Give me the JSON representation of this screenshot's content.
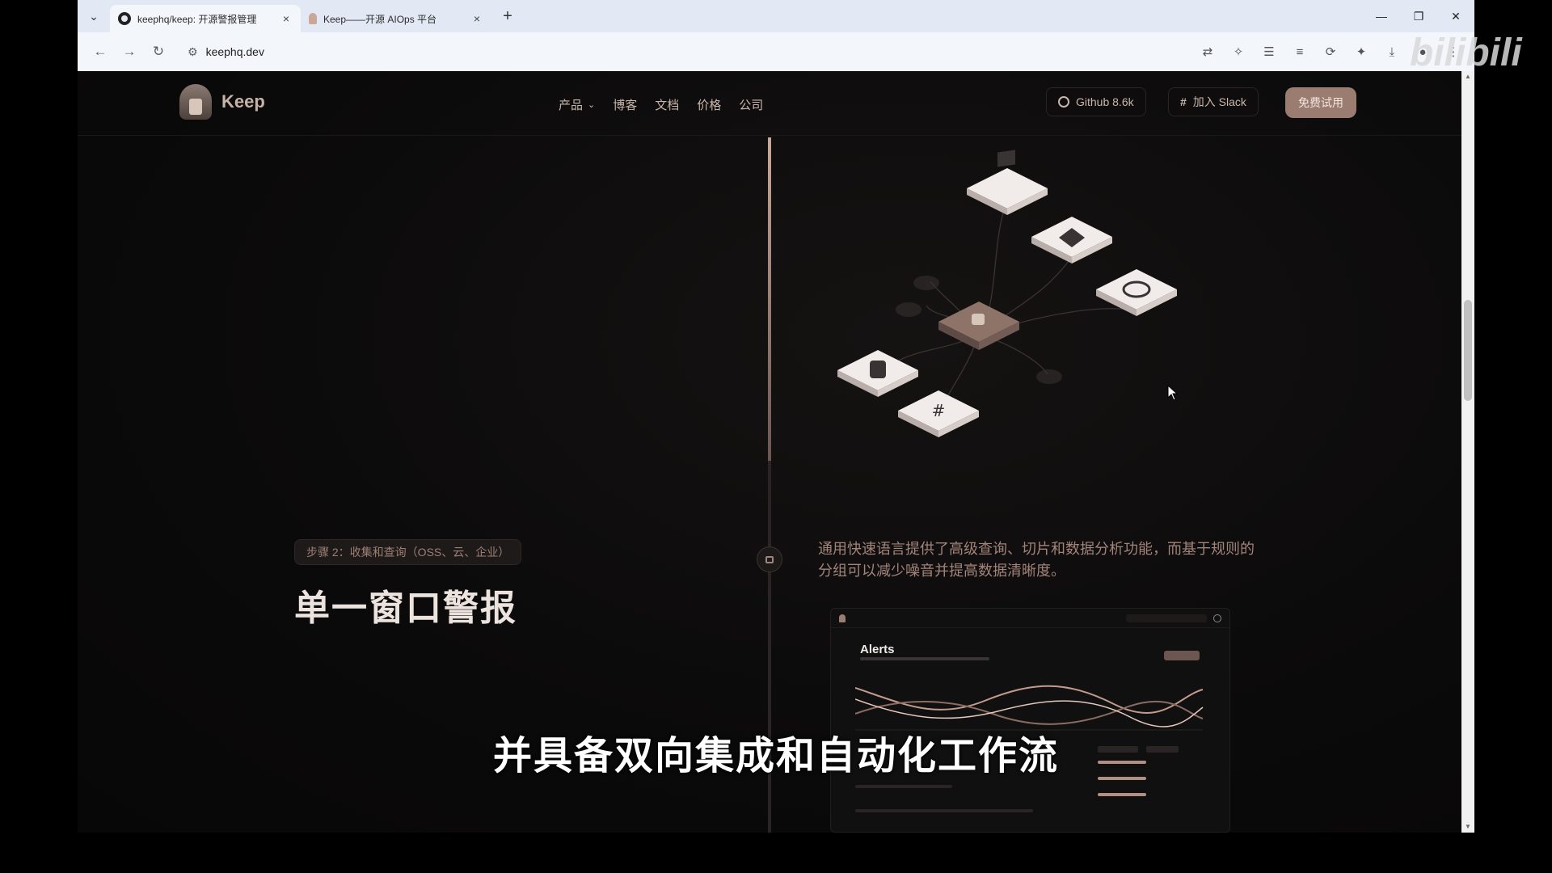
{
  "browser": {
    "tabs": [
      {
        "title": "keephq/keep: 开源警报管理",
        "active": true
      },
      {
        "title": "Keep——开源 AIOps 平台",
        "active": false
      }
    ],
    "tab_close": "×",
    "new_tab": "+",
    "address": "keephq.dev"
  },
  "site": {
    "logo_text": "Keep",
    "nav": [
      "产品",
      "博客",
      "文档",
      "价格",
      "公司"
    ],
    "github_label": "Github 8.6k",
    "slack_label": "加入 Slack",
    "trial_label": "免费试用"
  },
  "content": {
    "step_badge": "步骤 2：收集和查询（OSS、云、企业）",
    "heading": "单一窗口警报",
    "description": "通用快速语言提供了高级查询、切片和数据分析功能，而基于规则的分组可以减少噪音并提高数据清晰度。",
    "dashboard_title": "Alerts"
  },
  "overlay": {
    "subtitle": "并具备双向集成和自动化工作流",
    "watermark": "bilibili"
  },
  "colors": {
    "accent": "#9a7c70",
    "text_muted": "#a2847a",
    "page_bg": "#0b0a0a"
  }
}
